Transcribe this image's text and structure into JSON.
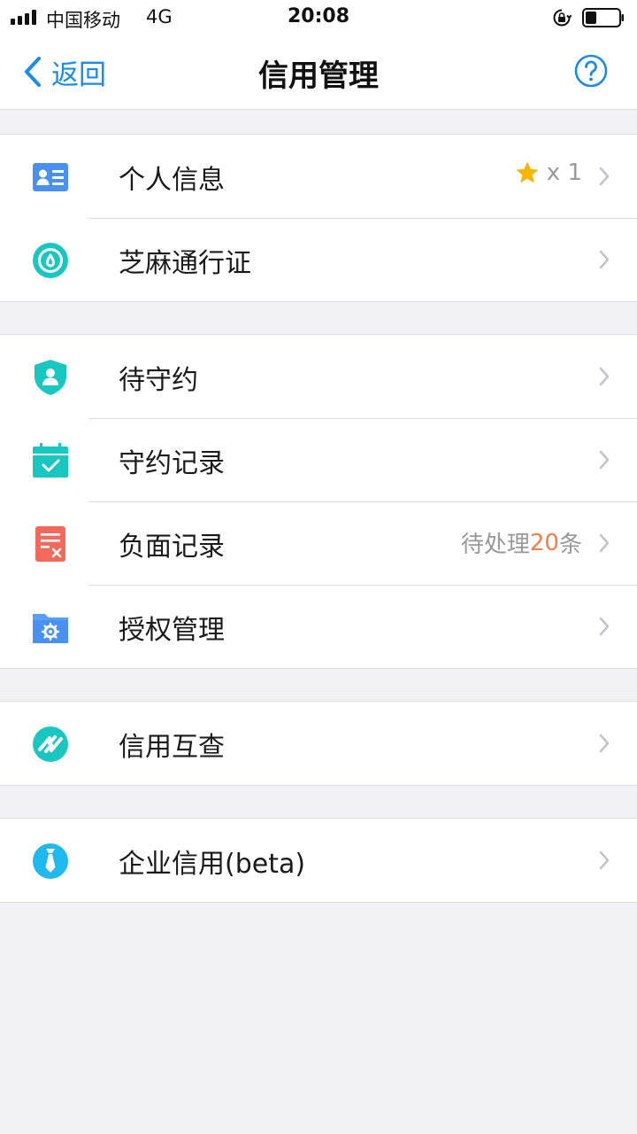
{
  "status_bar": {
    "carrier": "中国移动",
    "network": "4G",
    "time": "20:08"
  },
  "nav": {
    "back_label": "返回",
    "title": "信用管理"
  },
  "groups": [
    {
      "items": [
        {
          "label": "个人信息",
          "icon": "id-card-icon",
          "extra": {
            "star": true,
            "text": "x 1"
          }
        },
        {
          "label": "芝麻通行证",
          "icon": "sesame-pass-icon"
        }
      ]
    },
    {
      "items": [
        {
          "label": "待守约",
          "icon": "shield-user-icon"
        },
        {
          "label": "守约记录",
          "icon": "calendar-check-icon"
        },
        {
          "label": "负面记录",
          "icon": "negative-doc-icon",
          "extra": {
            "prefix": "待处理",
            "count": "20",
            "suffix": "条"
          }
        },
        {
          "label": "授权管理",
          "icon": "folder-gear-icon"
        }
      ]
    },
    {
      "items": [
        {
          "label": "信用互查",
          "icon": "mutual-check-icon"
        }
      ]
    },
    {
      "items": [
        {
          "label": "企业信用(beta)",
          "icon": "enterprise-tie-icon"
        }
      ]
    }
  ],
  "colors": {
    "accent_blue": "#1a8be8",
    "teal": "#19c7c1",
    "negative_red": "#f26a5b",
    "count_orange": "#f07f4a",
    "star_yellow": "#f7b500",
    "background": "#f2f2f6"
  }
}
